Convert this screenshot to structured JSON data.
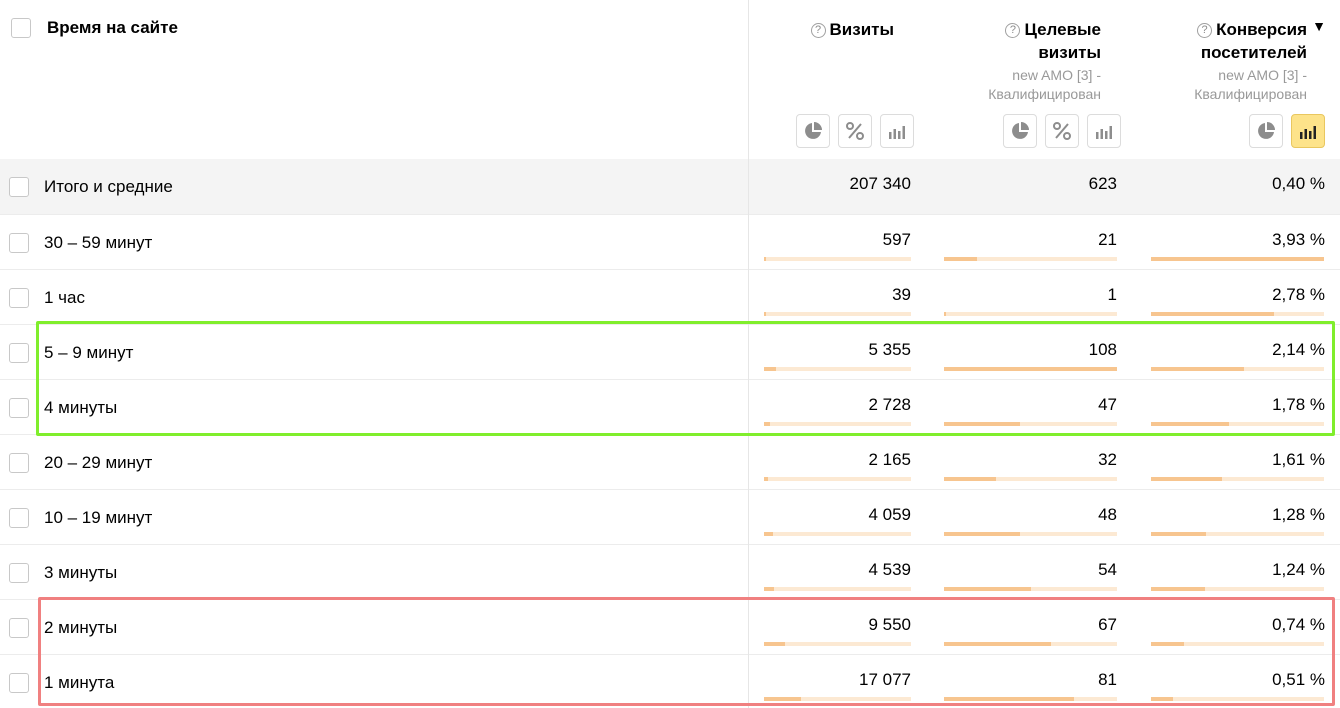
{
  "header": {
    "dimension_title": "Время на сайте",
    "metrics": [
      {
        "title_lines": [
          "Визиты"
        ],
        "goal_lines": [],
        "help_icon": "question-circle-icon"
      },
      {
        "title_lines": [
          "Целевые",
          "визиты"
        ],
        "goal_lines": [
          "new AMO [3] -",
          "Квалифицирован"
        ],
        "help_icon": "question-circle-icon"
      },
      {
        "title_lines": [
          "Конверсия",
          "посетителей"
        ],
        "goal_lines": [
          "new AMO [3] -",
          "Квалифицирован"
        ],
        "help_icon": "question-circle-icon",
        "sort": "▼"
      }
    ],
    "view_buttons": [
      [
        "pie-chart-icon",
        "percent-icon",
        "bar-chart-icon"
      ],
      [
        "pie-chart-icon",
        "percent-icon",
        "bar-chart-icon"
      ],
      [
        "pie-chart-icon",
        "bar-chart-icon"
      ]
    ],
    "active_view": "bar-chart-icon"
  },
  "colors": {
    "bar_fill": "#f7c58f",
    "bar_track": "#fce9d3",
    "highlight_green": "#80ee2c",
    "highlight_red": "#f08080",
    "active_button": "#fde38a"
  },
  "rows": [
    {
      "label": "Итого и средние",
      "visits": "207 340",
      "goal_visits": "623",
      "conversion": "0,40 %",
      "total": true
    },
    {
      "label": "30 – 59 минут",
      "visits": "597",
      "goal_visits": "21",
      "conversion": "3,93 %",
      "bars": [
        0.015,
        0.19,
        1.0
      ]
    },
    {
      "label": "1 час",
      "visits": "39",
      "goal_visits": "1",
      "conversion": "2,78 %",
      "bars": [
        0.002,
        0.01,
        0.71
      ]
    },
    {
      "label": "5 – 9 минут",
      "visits": "5 355",
      "goal_visits": "108",
      "conversion": "2,14 %",
      "bars": [
        0.08,
        1.0,
        0.54
      ]
    },
    {
      "label": "4 минуты",
      "visits": "2 728",
      "goal_visits": "47",
      "conversion": "1,78 %",
      "bars": [
        0.04,
        0.44,
        0.45
      ]
    },
    {
      "label": "20 – 29 минут",
      "visits": "2 165",
      "goal_visits": "32",
      "conversion": "1,61 %",
      "bars": [
        0.03,
        0.3,
        0.41
      ]
    },
    {
      "label": "10 – 19 минут",
      "visits": "4 059",
      "goal_visits": "48",
      "conversion": "1,28 %",
      "bars": [
        0.06,
        0.44,
        0.32
      ]
    },
    {
      "label": "3 минуты",
      "visits": "4 539",
      "goal_visits": "54",
      "conversion": "1,24 %",
      "bars": [
        0.07,
        0.5,
        0.31
      ]
    },
    {
      "label": "2 минуты",
      "visits": "9 550",
      "goal_visits": "67",
      "conversion": "0,74 %",
      "bars": [
        0.14,
        0.62,
        0.19
      ]
    },
    {
      "label": "1 минута",
      "visits": "17 077",
      "goal_visits": "81",
      "conversion": "0,51 %",
      "bars": [
        0.25,
        0.75,
        0.13
      ]
    }
  ]
}
